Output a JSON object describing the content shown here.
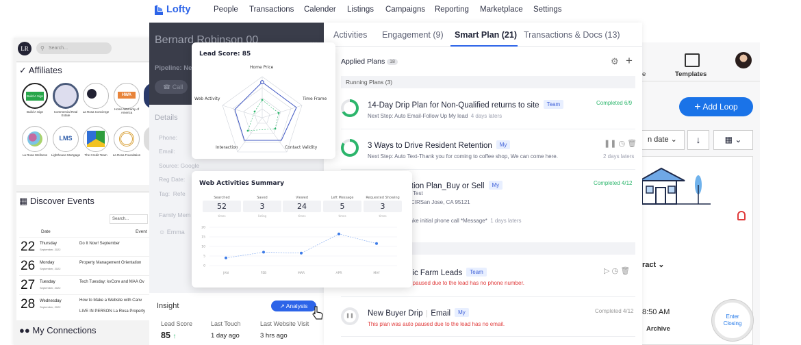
{
  "nav": {
    "brand": "Lofty",
    "items": [
      "People",
      "Transactions",
      "Calender",
      "Listings",
      "Campaigns",
      "Reporting",
      "Marketplace",
      "Settings"
    ]
  },
  "left_app": {
    "search_placeholder": "Search...",
    "affiliates_title": "Affiliates",
    "affiliates": [
      "Build A Sign",
      "Commercial Real Estate",
      "La Rosa Concierge",
      "Home Warranty of America",
      "La Rosa Wellness",
      "Lighthouse Mortgage",
      "The Credit Team",
      "La Rosa Foundation"
    ],
    "affiliate_logo_texts": [
      "Build A Sign",
      "HWA",
      "LMS"
    ],
    "events_title": "Discover Events",
    "events_search_placeholder": "Search...",
    "events_headers": [
      "Date",
      "Event"
    ],
    "events": [
      {
        "day": "22",
        "weekday": "Thursday",
        "month": "September, 2022",
        "title": "Do It Now! September"
      },
      {
        "day": "26",
        "weekday": "Monday",
        "month": "September, 2022",
        "title": "Property Management Orientation"
      },
      {
        "day": "27",
        "weekday": "Tuesday",
        "month": "September, 2022",
        "title": "Tech Tuesday: kvCore and MAA Ov"
      },
      {
        "day": "28",
        "weekday": "Wednesday",
        "month": "September, 2022",
        "title": "How to Make a Website with Canv"
      }
    ],
    "event_extra": "LIVE IN PERSON La Rosa Property",
    "connections_title": "My Connections"
  },
  "contact": {
    "name": "Bernard Robinson",
    "name_suffix": "00",
    "pipeline_label": "Pipeline: Ne",
    "call_button": "Call",
    "details_title": "Details",
    "fields": [
      "Phone:",
      "Email:",
      "Source: Google",
      "Reg Date:",
      "Tag:  Refe"
    ],
    "family_label": "Family Mem",
    "family_member": "Emma",
    "insight_title": "Insight",
    "analysis_button": "Analysis",
    "insight_cols": [
      {
        "label": "Lead Score",
        "value": "85"
      },
      {
        "label": "Last Touch",
        "value": "1 day ago"
      },
      {
        "label": "Last Website Visit",
        "value": "3 hrs ago"
      }
    ]
  },
  "lead_score": {
    "title": "Lead Score: 85",
    "axes": [
      "Home Price",
      "Time Frame",
      "Contact Validity",
      "Interaction",
      "Web Activity"
    ]
  },
  "web_summary": {
    "title": "Web Activities Summary",
    "stats": [
      {
        "label": "Searched",
        "value": "52",
        "sub": "times"
      },
      {
        "label": "Saved",
        "value": "3",
        "sub": "listing"
      },
      {
        "label": "Viewed",
        "value": "24",
        "sub": "times"
      },
      {
        "label": "Left Message",
        "value": "5",
        "sub": "times"
      },
      {
        "label": "Requested Showing",
        "value": "3",
        "sub": "times"
      }
    ]
  },
  "chart_data": {
    "type": "line",
    "title": "",
    "categories": [
      "JAN",
      "FEB",
      "MAR",
      "APR",
      "MAY"
    ],
    "values": [
      4,
      7,
      6.5,
      16.5,
      11.5
    ],
    "ylim": [
      0,
      20
    ],
    "yticks": [
      0,
      5,
      10,
      15,
      20
    ],
    "grid": true,
    "color": "#3d7be8"
  },
  "tabs": [
    {
      "label": "Activities"
    },
    {
      "label": "Engagement (9)"
    },
    {
      "label": "Smart Plan (21)",
      "active": true
    },
    {
      "label": "Transactions & Docs (13)"
    }
  ],
  "plans": {
    "applied_title": "Applied Plans",
    "applied_count": "18",
    "running_title": "Running Plans",
    "running_count": "(3)",
    "items": [
      {
        "title": "14-Day Drip Plan for Non-Qualified returns to site",
        "tag": "Team",
        "status": "Completed 6/9",
        "next": "Next Step: Auto Email-Follow Up My lead",
        "when": "4 days laters"
      },
      {
        "title": "3 Ways to Drive Resident Retention",
        "tag": "My",
        "status": "",
        "next": "Next Step: Auto Text-Thank you for coming to coffee shop,  We can come here.",
        "when": "2 days laters"
      },
      {
        "title": "ction Plan_Buy or Sell",
        "tag": "My",
        "status": "Completed 4/12",
        "line2": "Test",
        "line3": "CIRSan Jose, CA 95121",
        "next": "lake initial phone call *Message*",
        "when": "1 days laters"
      },
      {
        "title": "hic Farm Leads",
        "tag": "Team",
        "status": "",
        "note": "o paused due to the lead has no phone number."
      },
      {
        "title": "New Buyer Drip",
        "title2": "Email",
        "tag": "My",
        "status": "Completed 4/12",
        "note": "This plan was auto paused due to the lead has no email."
      }
    ]
  },
  "right_app": {
    "templates_label": "Templates",
    "add_loop_button": "Add Loop",
    "sort_label": "n date",
    "contract_label": "ract",
    "time_label": "8:50 AM",
    "archive_label": "Archive",
    "enter_closing": "Enter Closing"
  },
  "colors": {
    "brand_blue": "#2d64e8",
    "green": "#2bb56b",
    "red": "#e03b3b"
  }
}
